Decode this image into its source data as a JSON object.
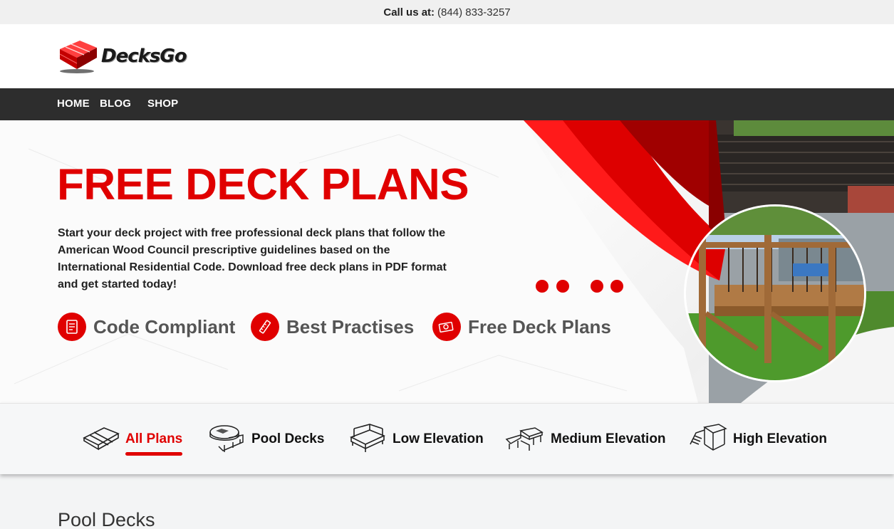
{
  "topbar": {
    "call_label": "Call us at:",
    "phone": "(844) 833-3257"
  },
  "header": {
    "logo_text": "DecksGo"
  },
  "nav": {
    "items": [
      "HOME",
      "BLOG",
      "SHOP"
    ]
  },
  "hero": {
    "title": "FREE DECK PLANS",
    "description": "Start your deck project with free professional deck plans that follow the American Wood Council prescriptive guidelines based on the International Residential Code. Download free deck plans in PDF format and get started today!",
    "features": [
      {
        "label": "Code Compliant",
        "icon": "document-icon"
      },
      {
        "label": "Best Practises",
        "icon": "ruler-icon"
      },
      {
        "label": "Free Deck Plans",
        "icon": "money-icon"
      }
    ],
    "carousel_dots": 4,
    "accent_color": "#e00000"
  },
  "tabs": {
    "items": [
      {
        "label": "All Plans",
        "icon": "deck-boards-icon",
        "active": true
      },
      {
        "label": "Pool Decks",
        "icon": "pool-deck-icon",
        "active": false
      },
      {
        "label": "Low Elevation",
        "icon": "low-deck-icon",
        "active": false
      },
      {
        "label": "Medium Elevation",
        "icon": "medium-deck-icon",
        "active": false
      },
      {
        "label": "High Elevation",
        "icon": "high-deck-icon",
        "active": false
      }
    ]
  },
  "section": {
    "title": "Pool Decks"
  }
}
